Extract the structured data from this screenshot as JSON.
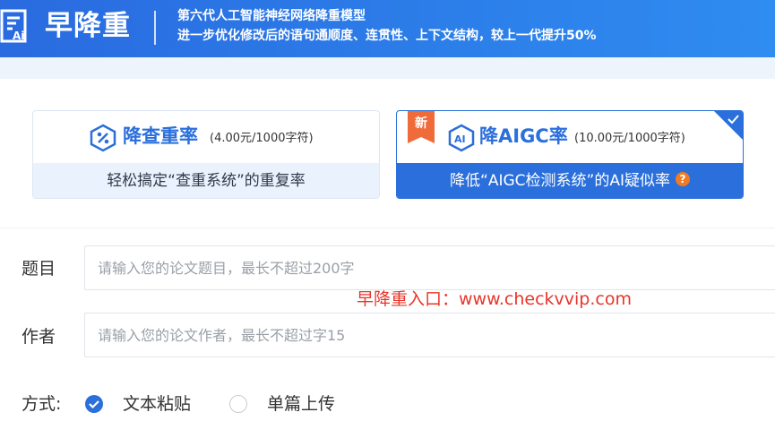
{
  "header": {
    "logo_text": "早降重",
    "tagline_line1": "第六代人工智能神经网络降重模型",
    "tagline_line2": "进一步优化修改后的语句通顺度、连贯性、上下文结构，较上一代提升50%"
  },
  "services": [
    {
      "title": "降查重率",
      "price": "(4.00元/1000字符)",
      "description": "轻松搞定“查重系统”的重复率",
      "icon": "percent-shield-icon",
      "selected": false
    },
    {
      "title": "降AIGC率",
      "price": "(10.00元/1000字符)",
      "description": "降低“AIGC检测系统”的AI疑似率",
      "icon": "ai-shield-icon",
      "badge": "新",
      "help_icon": "?",
      "selected": true
    }
  ],
  "form": {
    "title_label": "题目",
    "title_placeholder": "请输入您的论文题目，最长不超过200字",
    "author_label": "作者",
    "author_placeholder": "请输入您的论文作者，最长不超过字15",
    "method_label": "方式:",
    "methods": [
      {
        "label": "文本粘贴",
        "selected": true
      },
      {
        "label": "单篇上传",
        "selected": false
      }
    ]
  },
  "watermark": "早降重入口：www.checkvvip.com",
  "colors": {
    "primary": "#2a6fdb",
    "badge": "#f06b3a",
    "watermark": "#e8352b",
    "help": "#f07b22"
  }
}
